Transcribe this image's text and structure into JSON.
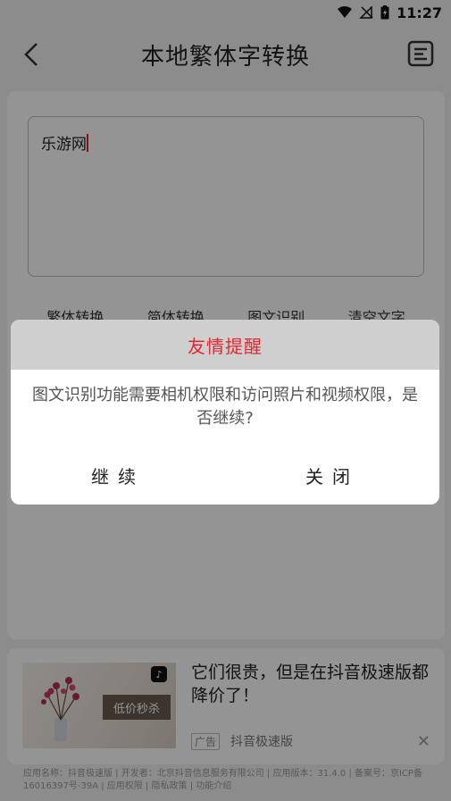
{
  "status_bar": {
    "time": "11:27",
    "icons": [
      "wifi-icon",
      "signal-off-icon",
      "battery-charging-icon"
    ]
  },
  "app_bar": {
    "title": "本地繁体字转换",
    "back_icon": "chevron-left-icon",
    "menu_icon": "document-list-icon"
  },
  "editor": {
    "text": "乐游网"
  },
  "actions": [
    {
      "label": "繁体转换"
    },
    {
      "label": "简体转换"
    },
    {
      "label": "图文识别"
    },
    {
      "label": "清空文字"
    }
  ],
  "ad": {
    "headline": "它们很贵，但是在抖音极速版都降价了！",
    "ad_tag": "广告",
    "advertiser": "抖音极速版",
    "thumb_tag": "低价秒杀",
    "close_icon": "close-icon",
    "disclosure": "应用名称：抖音极速版 | 开发者：北京抖音信息服务有限公司 | 应用版本：31.4.0 | 备案号：京ICP备16016397号-39A | 应用权限 | 隐私政策 | 功能介绍"
  },
  "dialog": {
    "title": "友情提醒",
    "message": "图文识别功能需要相机权限和访问照片和视频权限，是否继续?",
    "continue_label": "继续",
    "close_label": "关闭"
  },
  "colors": {
    "dialog_title": "#e8252f",
    "caret": "#e0202a",
    "overlay": "rgba(0,0,0,0.42)"
  }
}
